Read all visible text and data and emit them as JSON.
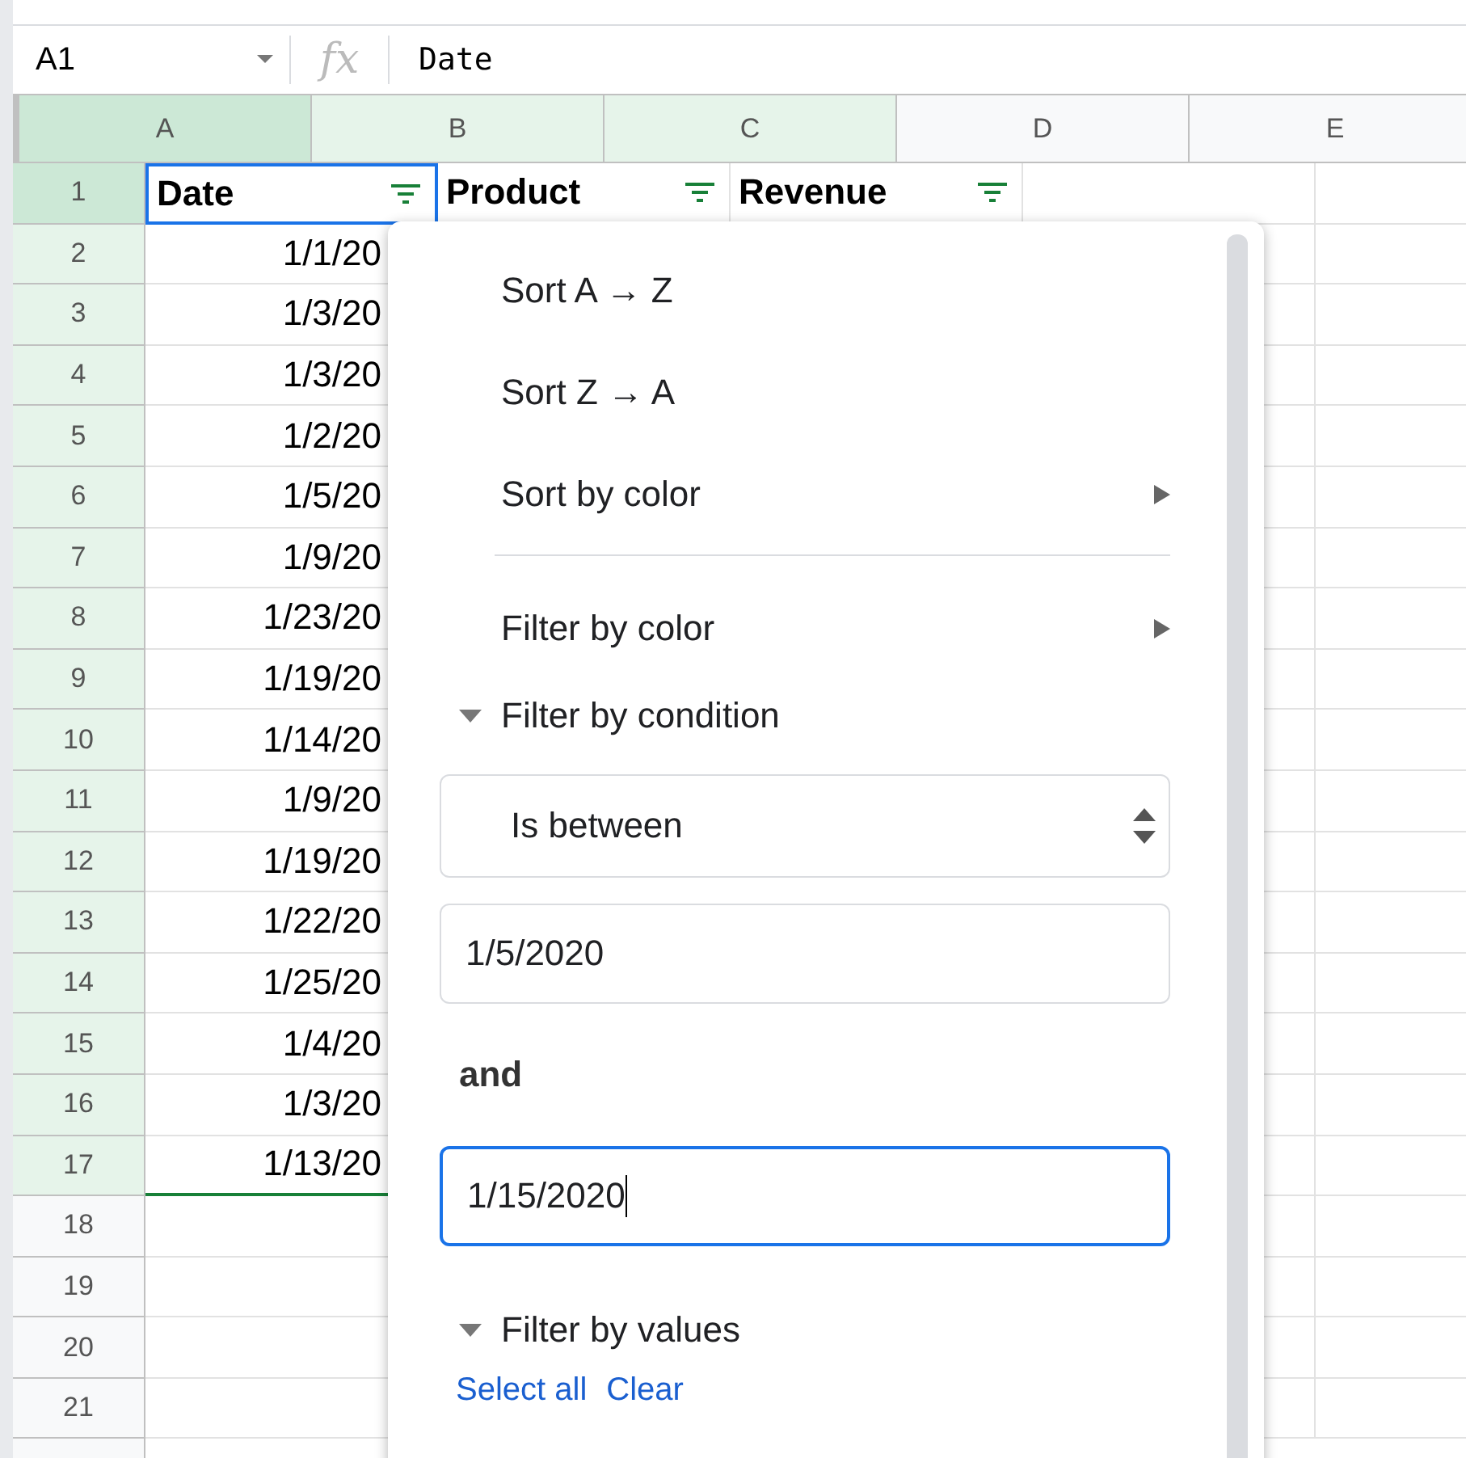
{
  "formula_bar": {
    "name_box": "A1",
    "fx": "fx",
    "value": "Date"
  },
  "columns": [
    {
      "label": "A",
      "selected": true,
      "highlighted": true
    },
    {
      "label": "B",
      "selected": false,
      "highlighted": true
    },
    {
      "label": "C",
      "selected": false,
      "highlighted": true
    },
    {
      "label": "D",
      "selected": false,
      "highlighted": false
    },
    {
      "label": "E",
      "selected": false,
      "highlighted": false
    }
  ],
  "header_row": {
    "number": "1",
    "cells": [
      {
        "text": "Date",
        "filter": true,
        "selected": true
      },
      {
        "text": "Product",
        "filter": true,
        "selected": false
      },
      {
        "text": "Revenue",
        "filter": true,
        "selected": false
      }
    ]
  },
  "rows": [
    {
      "number": "2",
      "date": "1/1/20",
      "highlighted": true
    },
    {
      "number": "3",
      "date": "1/3/20",
      "highlighted": true
    },
    {
      "number": "4",
      "date": "1/3/20",
      "highlighted": true
    },
    {
      "number": "5",
      "date": "1/2/20",
      "highlighted": true
    },
    {
      "number": "6",
      "date": "1/5/20",
      "highlighted": true
    },
    {
      "number": "7",
      "date": "1/9/20",
      "highlighted": true
    },
    {
      "number": "8",
      "date": "1/23/20",
      "highlighted": true
    },
    {
      "number": "9",
      "date": "1/19/20",
      "highlighted": true
    },
    {
      "number": "10",
      "date": "1/14/20",
      "highlighted": true
    },
    {
      "number": "11",
      "date": "1/9/20",
      "highlighted": true
    },
    {
      "number": "12",
      "date": "1/19/20",
      "highlighted": true
    },
    {
      "number": "13",
      "date": "1/22/20",
      "highlighted": true
    },
    {
      "number": "14",
      "date": "1/25/20",
      "highlighted": true
    },
    {
      "number": "15",
      "date": "1/4/20",
      "highlighted": true
    },
    {
      "number": "16",
      "date": "1/3/20",
      "highlighted": true
    },
    {
      "number": "17",
      "date": "1/13/20",
      "highlighted": true
    },
    {
      "number": "18",
      "highlighted": false
    },
    {
      "number": "19",
      "highlighted": false
    },
    {
      "number": "20",
      "highlighted": false
    },
    {
      "number": "21",
      "highlighted": false
    }
  ],
  "menu": {
    "items": [
      {
        "kind": "action",
        "label": "Sort A → Z",
        "submenu": false
      },
      {
        "kind": "action",
        "label": "Sort Z → A",
        "submenu": false
      },
      {
        "kind": "action",
        "label": "Sort by color",
        "submenu": true
      },
      {
        "kind": "divider"
      },
      {
        "kind": "action",
        "label": "Filter by color",
        "submenu": true
      },
      {
        "kind": "section",
        "label": "Filter by condition",
        "expanded": true
      }
    ],
    "condition": {
      "select": "Is between",
      "value1": "1/5/2020",
      "joiner": "and",
      "value2": "1/15/2020",
      "value2_focused": true
    },
    "values_section": {
      "label": "Filter by values",
      "expanded": true
    },
    "links": [
      "Select all",
      "Clear"
    ]
  }
}
